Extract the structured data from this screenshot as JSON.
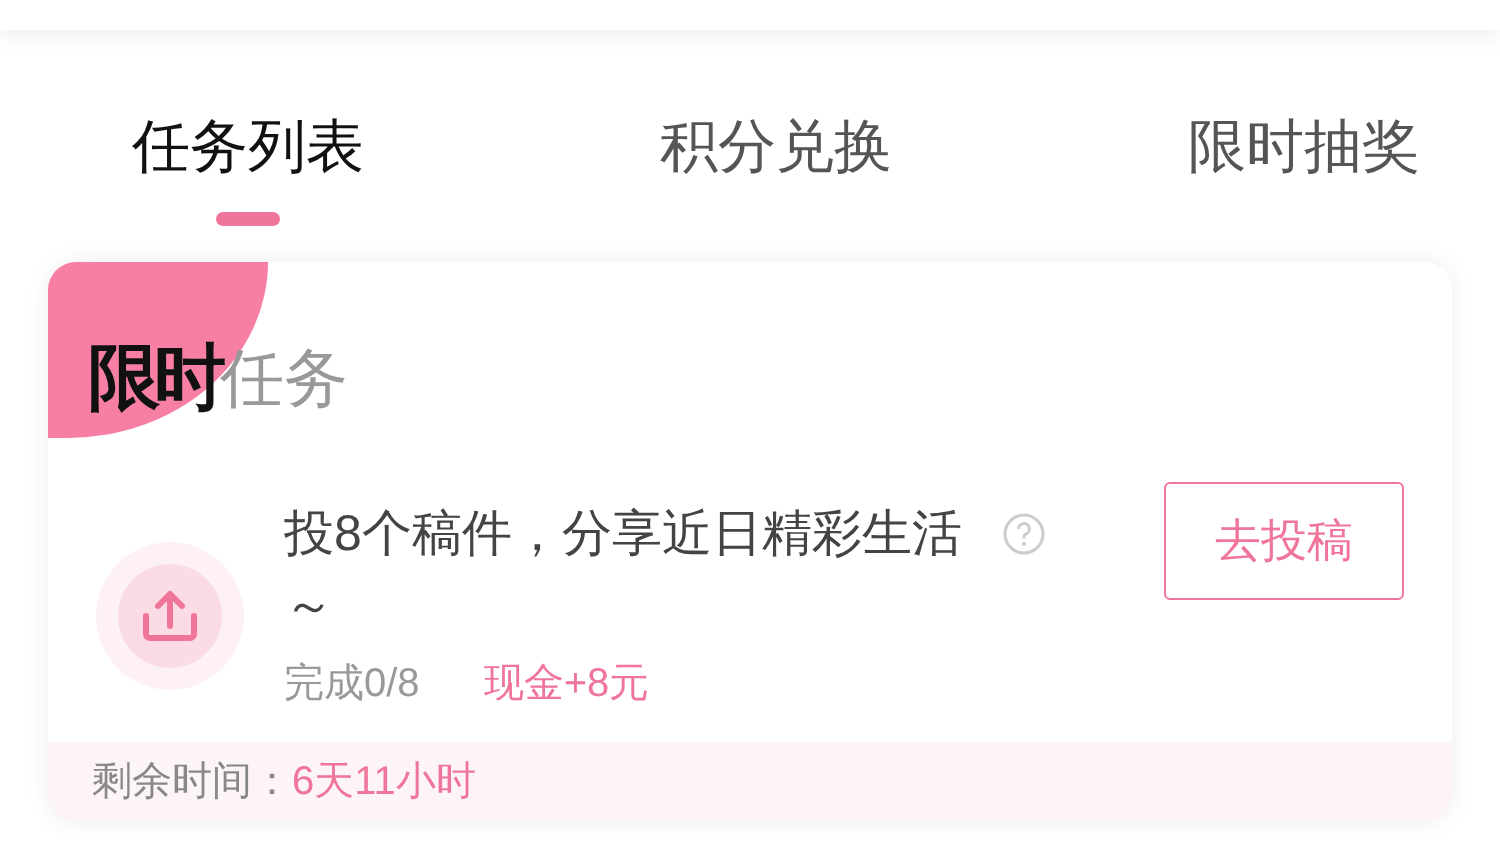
{
  "tabs": [
    {
      "label": "任务列表",
      "selected": true
    },
    {
      "label": "积分兑换",
      "selected": false
    },
    {
      "label": "限时抽奖",
      "selected": false
    }
  ],
  "card": {
    "badge": "限时",
    "title": "任务",
    "task": {
      "title": "投8个稿件，分享近日精彩生活～",
      "progress": "完成0/8",
      "reward": "现金+8元",
      "button": "去投稿"
    },
    "footer": {
      "label": "剩余时间：",
      "value": "6天11小时"
    }
  }
}
